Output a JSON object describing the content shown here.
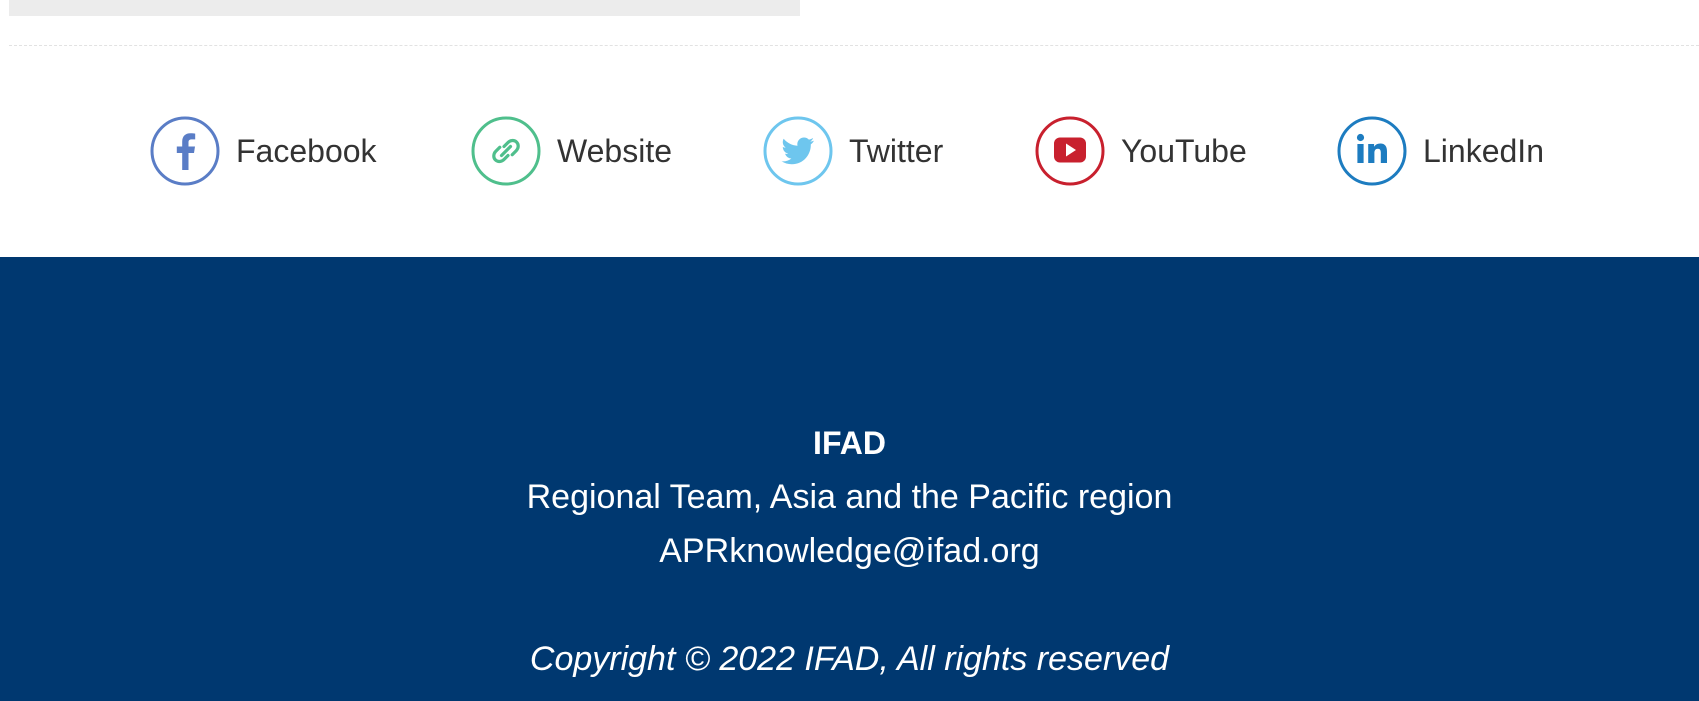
{
  "social": {
    "items": [
      {
        "label": "Facebook",
        "icon": "facebook-icon",
        "color": "#5a7dc6"
      },
      {
        "label": "Website",
        "icon": "link-icon",
        "color": "#4fbf8c"
      },
      {
        "label": "Twitter",
        "icon": "twitter-icon",
        "color": "#6ec6ee"
      },
      {
        "label": "YouTube",
        "icon": "youtube-icon",
        "color": "#c8202e"
      },
      {
        "label": "LinkedIn",
        "icon": "linkedin-icon",
        "color": "#1d7cc0"
      }
    ]
  },
  "footer": {
    "org": "IFAD",
    "team": "Regional Team, Asia and the Pacific region",
    "email": "APRknowledge@ifad.org",
    "copyright": "Copyright © 2022 IFAD, All rights reserved",
    "background": "#003870"
  }
}
